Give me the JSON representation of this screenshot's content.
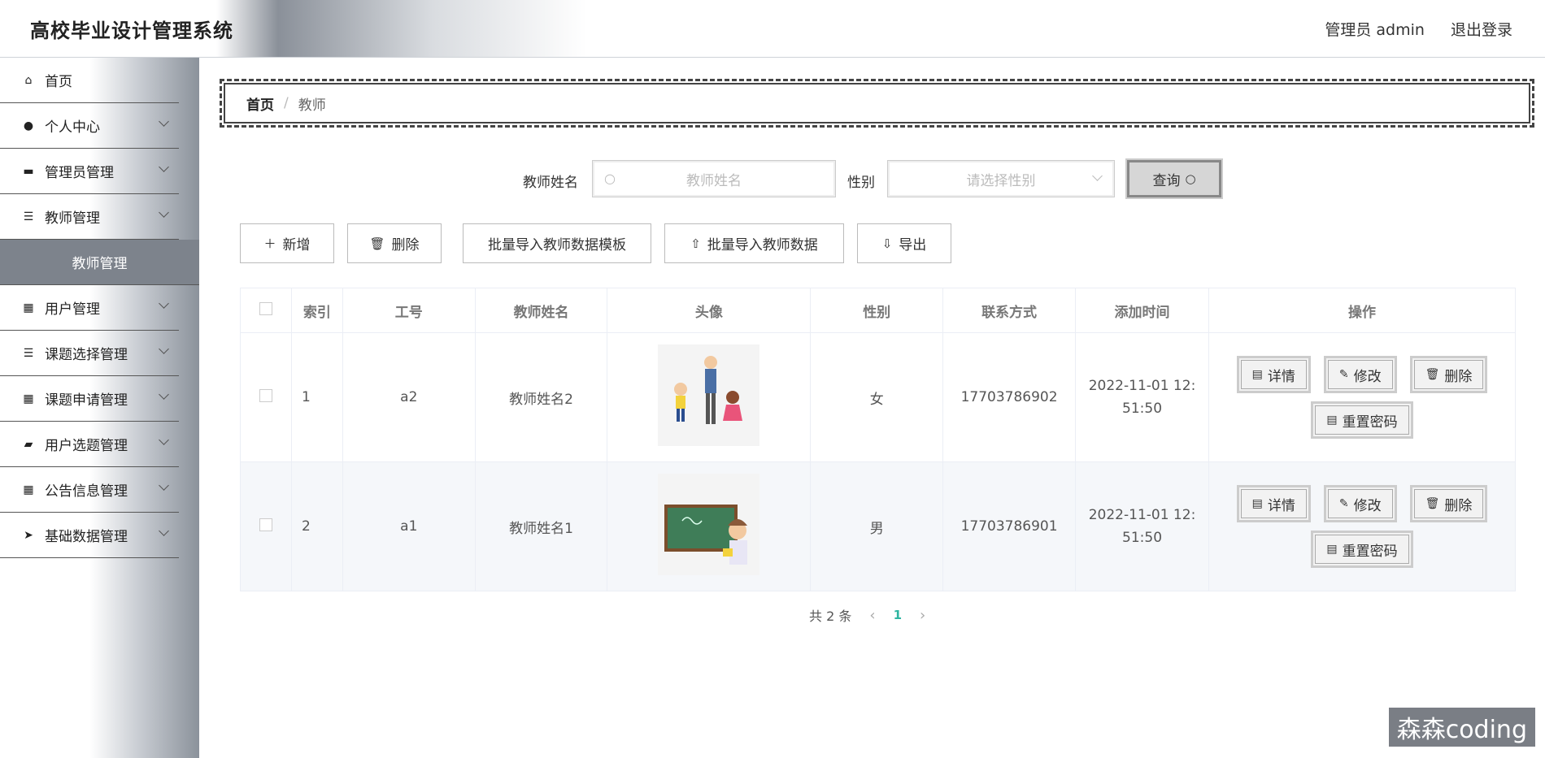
{
  "header": {
    "title": "高校毕业设计管理系统",
    "user_label": "管理员 admin",
    "logout": "退出登录"
  },
  "sidebar": {
    "items": [
      {
        "label": "首页",
        "icon": "home-icon"
      },
      {
        "label": "个人中心",
        "icon": "user-icon"
      },
      {
        "label": "管理员管理",
        "icon": "inbox-icon"
      },
      {
        "label": "教师管理",
        "icon": "list-icon"
      },
      {
        "label": "用户管理",
        "icon": "grid-icon"
      },
      {
        "label": "课题选择管理",
        "icon": "menu-icon"
      },
      {
        "label": "课题申请管理",
        "icon": "grid-icon"
      },
      {
        "label": "用户选题管理",
        "icon": "briefcase-icon"
      },
      {
        "label": "公告信息管理",
        "icon": "grid-icon"
      },
      {
        "label": "基础数据管理",
        "icon": "send-icon"
      }
    ],
    "active_sub": "教师管理"
  },
  "breadcrumb": {
    "home": "首页",
    "current": "教师"
  },
  "search": {
    "name_label": "教师姓名",
    "name_placeholder": "教师姓名",
    "gender_label": "性别",
    "gender_placeholder": "请选择性别",
    "query_button": "查询"
  },
  "toolbar": {
    "add": "新增",
    "delete": "删除",
    "template": "批量导入教师数据模板",
    "import": "批量导入教师数据",
    "export": "导出"
  },
  "table": {
    "columns": [
      "索引",
      "工号",
      "教师姓名",
      "头像",
      "性别",
      "联系方式",
      "添加时间",
      "操作"
    ],
    "rows": [
      {
        "index": "1",
        "code": "a2",
        "name": "教师姓名2",
        "gender": "女",
        "phone": "17703786902",
        "time": "2022-11-01 12:51:50"
      },
      {
        "index": "2",
        "code": "a1",
        "name": "教师姓名1",
        "gender": "男",
        "phone": "17703786901",
        "time": "2022-11-01 12:51:50"
      }
    ],
    "ops": {
      "detail": "详情",
      "edit": "修改",
      "delete": "删除",
      "reset": "重置密码"
    }
  },
  "pagination": {
    "total": "共 2 条",
    "current": "1"
  },
  "watermark": "森森coding"
}
